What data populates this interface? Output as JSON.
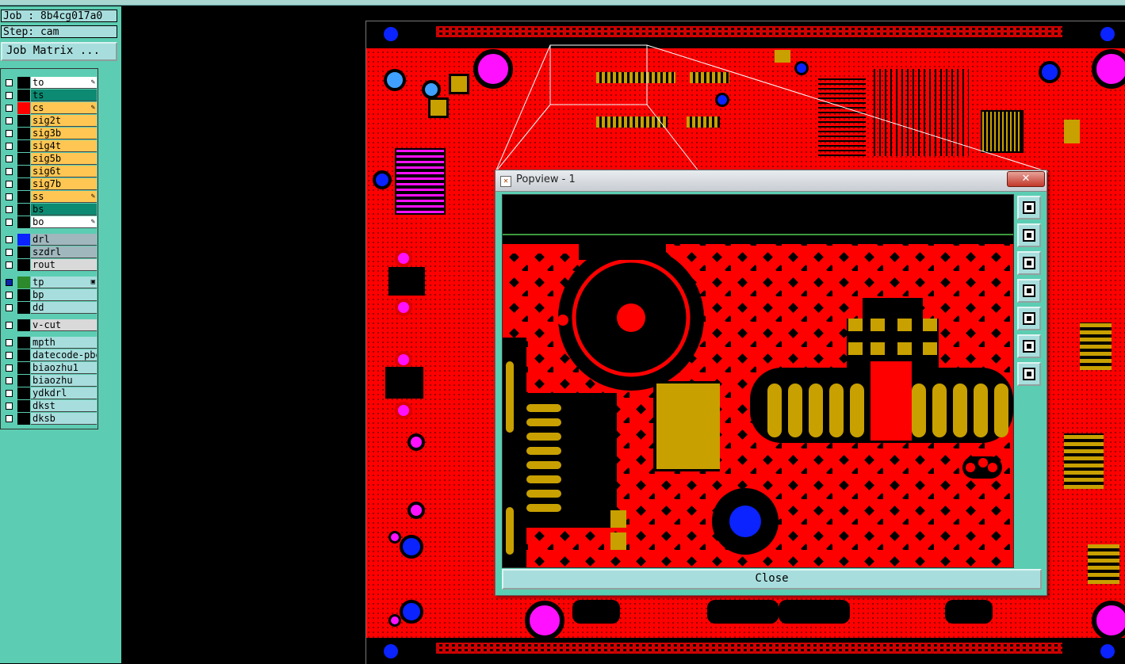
{
  "job": {
    "label": "Job : 8b4cg017a0",
    "step": "Step: cam",
    "matrix_button": "Job Matrix ..."
  },
  "layers": [
    {
      "name": "to",
      "color": "#ffffff",
      "swatch": "#000000",
      "checked": false,
      "mark": "✎"
    },
    {
      "name": "ts",
      "color": "#0d8a72",
      "swatch": "#000000",
      "checked": false,
      "mark": ""
    },
    {
      "name": "cs",
      "color": "#ffc653",
      "swatch": "#ff0000",
      "checked": false,
      "mark": "✎"
    },
    {
      "name": "sig2t",
      "color": "#ffc653",
      "swatch": "#000000",
      "checked": false,
      "mark": ""
    },
    {
      "name": "sig3b",
      "color": "#ffc653",
      "swatch": "#000000",
      "checked": false,
      "mark": ""
    },
    {
      "name": "sig4t",
      "color": "#ffc653",
      "swatch": "#000000",
      "checked": false,
      "mark": ""
    },
    {
      "name": "sig5b",
      "color": "#ffc653",
      "swatch": "#000000",
      "checked": false,
      "mark": ""
    },
    {
      "name": "sig6t",
      "color": "#ffc653",
      "swatch": "#000000",
      "checked": false,
      "mark": ""
    },
    {
      "name": "sig7b",
      "color": "#ffc653",
      "swatch": "#000000",
      "checked": false,
      "mark": ""
    },
    {
      "name": "ss",
      "color": "#ffc653",
      "swatch": "#000000",
      "checked": false,
      "mark": "✎"
    },
    {
      "name": "bs",
      "color": "#0d8a72",
      "swatch": "#000000",
      "checked": false,
      "mark": ""
    },
    {
      "name": "bo",
      "color": "#ffffff",
      "swatch": "#000000",
      "checked": false,
      "mark": "✎"
    },
    {
      "name": "drl",
      "color": "#9fb7bd",
      "swatch": "#0a23ff",
      "checked": false,
      "mark": ""
    },
    {
      "name": "szdrl",
      "color": "#9fb7bd",
      "swatch": "#000000",
      "checked": false,
      "mark": ""
    },
    {
      "name": "rout",
      "color": "#d9d9d9",
      "swatch": "#000000",
      "checked": false,
      "mark": ""
    },
    {
      "name": "tp",
      "color": "#a7dedd",
      "swatch": "#2c8a2c",
      "checked": true,
      "mark": "▣"
    },
    {
      "name": "bp",
      "color": "#a7dedd",
      "swatch": "#000000",
      "checked": false,
      "mark": ""
    },
    {
      "name": "dd",
      "color": "#a7dedd",
      "swatch": "#000000",
      "checked": false,
      "mark": ""
    },
    {
      "name": "v-cut",
      "color": "#d9d9d9",
      "swatch": "#000000",
      "checked": false,
      "mark": ""
    },
    {
      "name": "mpth",
      "color": "#a7dedd",
      "swatch": "#000000",
      "checked": false,
      "mark": ""
    },
    {
      "name": "datecode-pbe",
      "color": "#a7dedd",
      "swatch": "#000000",
      "checked": false,
      "mark": ""
    },
    {
      "name": "biaozhu1",
      "color": "#a7dedd",
      "swatch": "#000000",
      "checked": false,
      "mark": ""
    },
    {
      "name": "biaozhu",
      "color": "#a7dedd",
      "swatch": "#000000",
      "checked": false,
      "mark": ""
    },
    {
      "name": "ydkdrl",
      "color": "#a7dedd",
      "swatch": "#000000",
      "checked": false,
      "mark": ""
    },
    {
      "name": "dkst",
      "color": "#a7dedd",
      "swatch": "#000000",
      "checked": false,
      "mark": ""
    },
    {
      "name": "dksb",
      "color": "#a7dedd",
      "swatch": "#000000",
      "checked": false,
      "mark": ""
    }
  ],
  "popview": {
    "title": "Popview - 1",
    "close_label": "Close",
    "close_x": "✕",
    "tools": [
      "zoom-window-icon",
      "pan-up-icon",
      "pan-down-icon",
      "pan-left-icon",
      "pan-right-icon",
      "zoom-fit-icon",
      "zoom-center-icon"
    ]
  },
  "colors": {
    "panel": "#5ccdb2",
    "copper": "#ff0000",
    "pad": "#c8a000",
    "via": "#ff00ff",
    "drill": "#0a23ff"
  }
}
